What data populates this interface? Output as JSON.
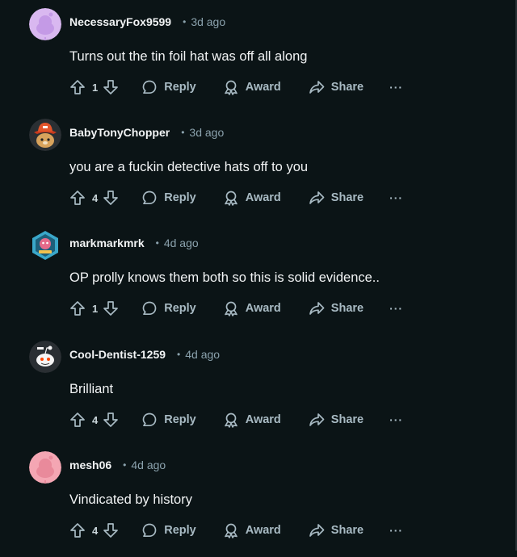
{
  "comments": [
    {
      "username": "NecessaryFox9599",
      "time": "3d ago",
      "text": "Turns out the tin foil hat was off all along",
      "score": "1",
      "avatar_icon": "snoo-purple-avatar-icon",
      "avatar_color": "#d9b8f0"
    },
    {
      "username": "BabyTonyChopper",
      "time": "3d ago",
      "text": "you are a fuckin detective hats off to you",
      "score": "4",
      "avatar_icon": "chopper-hat-avatar-icon",
      "avatar_color": "#2a2f33"
    },
    {
      "username": "markmarkmrk",
      "time": "4d ago",
      "text": "OP prolly knows them both so this is solid evidence..",
      "score": "1",
      "avatar_icon": "hexagon-badge-avatar-icon",
      "avatar_color": "#3aa7c9"
    },
    {
      "username": "Cool-Dentist-1259",
      "time": "4d ago",
      "text": "Brilliant",
      "score": "4",
      "avatar_icon": "snoo-white-avatar-icon",
      "avatar_color": "#2a2f33"
    },
    {
      "username": "mesh06",
      "time": "4d ago",
      "text": "Vindicated by history",
      "score": "4",
      "avatar_icon": "snoo-pink-avatar-icon",
      "avatar_color": "#f4a6b3"
    }
  ],
  "labels": {
    "separator": "•",
    "reply": "Reply",
    "award": "Award",
    "share": "Share",
    "more": "···"
  },
  "colors": {
    "background": "#0b1416",
    "text": "#f2f4f5",
    "muted": "#8ba2ad",
    "action": "#a8bac3"
  }
}
